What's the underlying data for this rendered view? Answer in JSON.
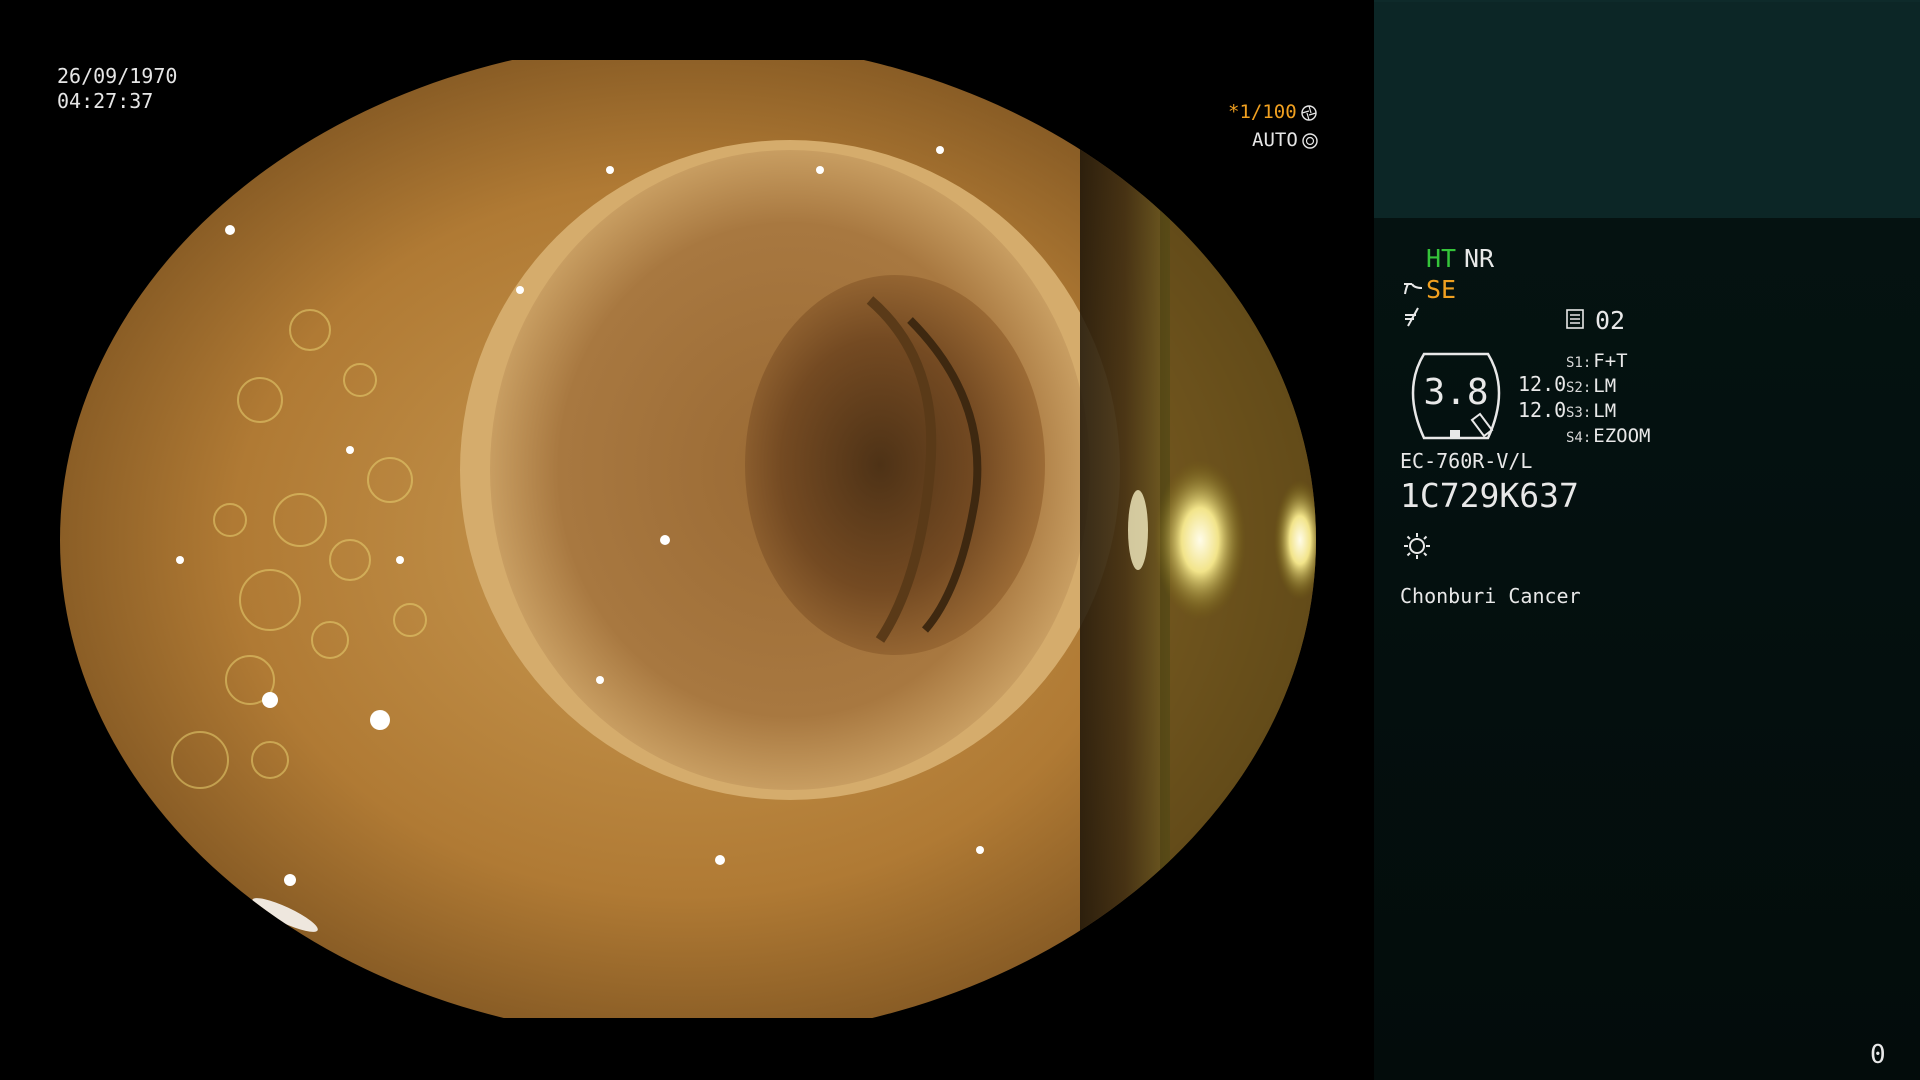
{
  "overlay": {
    "date": "26/09/1970",
    "time": "04:27:37",
    "shutter": "*1/100",
    "iris": "AUTO",
    "shutter_icon": "aperture-icon",
    "iris_icon": "iris-icon"
  },
  "panel": {
    "ht": "HT",
    "nr": "NR",
    "se": "SE",
    "se_icon": "wave-hand-icon",
    "freeze_icon": "freeze-icon",
    "memo_icon": "memo-icon",
    "memo_value": "02",
    "zoom_value": "3.8",
    "zoom_icon": "zoom-gauge-icon",
    "ratio_1": "12.0",
    "ratio_2": "12.0",
    "switches": [
      {
        "key": "S1",
        "value": "F+T"
      },
      {
        "key": "S2",
        "value": "LM"
      },
      {
        "key": "S3",
        "value": "LM"
      },
      {
        "key": "S4",
        "value": "EZOOM"
      }
    ],
    "scope_model": "EC-760R-V/L",
    "serial": "1C729K637",
    "light_icon": "sun-icon",
    "hospital": "Chonburi Cancer",
    "page_number": "0"
  },
  "colors": {
    "green": "#35c43a",
    "orange": "#f0a020",
    "panel_top": "#0c2626",
    "panel_bg": "#041110"
  }
}
